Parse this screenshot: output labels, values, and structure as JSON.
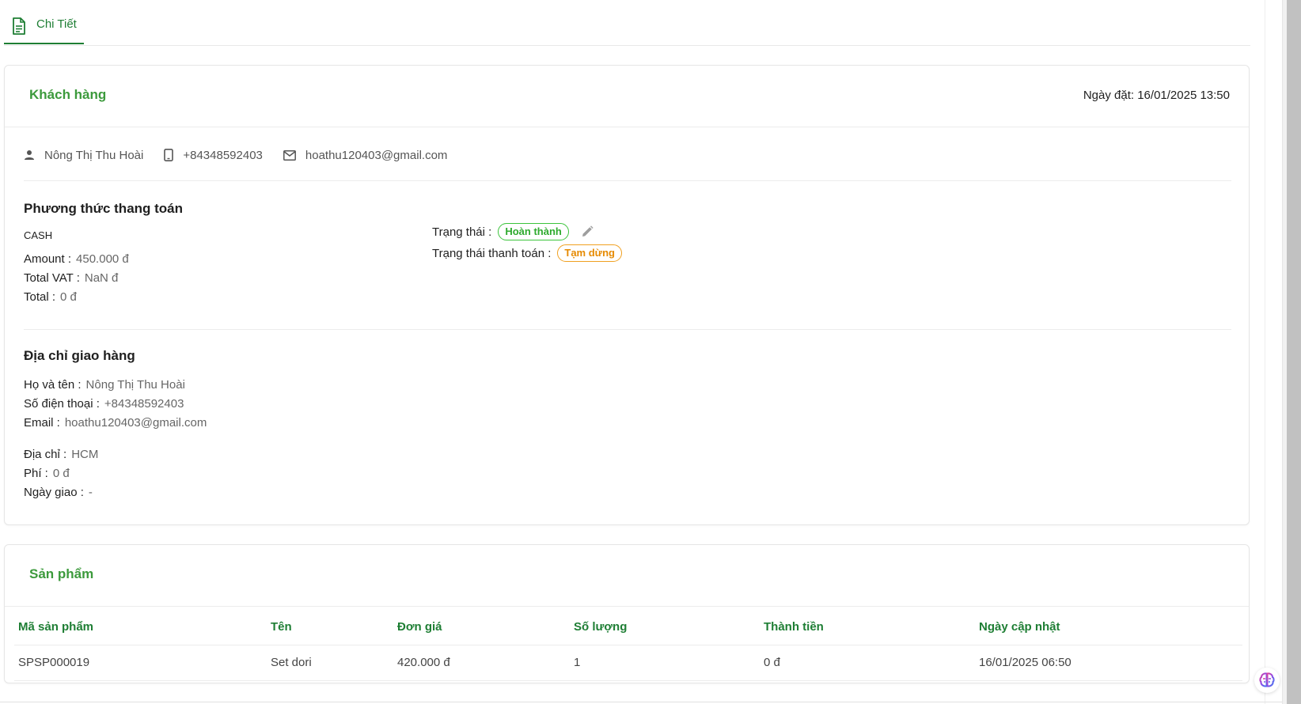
{
  "tabs": [
    {
      "label": "Chi Tiết",
      "icon": "document-icon"
    }
  ],
  "customer_card": {
    "title": "Khách hàng",
    "order_date": "Ngày đặt: 16/01/2025 13:50",
    "contact": {
      "name": "Nông Thị Thu Hoài",
      "phone": "+84348592403",
      "email": "hoathu120403@gmail.com"
    },
    "payment": {
      "title": "Phương thức thang toán",
      "method": "CASH",
      "amount_label": "Amount :",
      "amount_value": "450.000 đ",
      "vat_label": "Total VAT :",
      "vat_value": "NaN đ",
      "total_label": "Total :",
      "total_value": "0 đ"
    },
    "status": {
      "status_label": "Trạng thái :",
      "status_value": "Hoàn thành",
      "payment_status_label": "Trạng thái thanh toán :",
      "payment_status_value": "Tạm dừng"
    },
    "shipping": {
      "title": "Địa chỉ giao hàng",
      "name_label": "Họ và tên :",
      "name_value": "Nông Thị Thu Hoài",
      "phone_label": "Số điện thoại :",
      "phone_value": "+84348592403",
      "email_label": "Email :",
      "email_value": "hoathu120403@gmail.com",
      "address_label": "Địa chỉ :",
      "address_value": "HCM",
      "fee_label": "Phí :",
      "fee_value": "0 đ",
      "delivery_label": "Ngày giao :",
      "delivery_value": "-"
    }
  },
  "products_card": {
    "title": "Sản phẩm",
    "columns": [
      "Mã sản phẩm",
      "Tên",
      "Đơn giá",
      "Số lượng",
      "Thành tiền",
      "Ngày cập nhật"
    ],
    "rows": [
      [
        "SPSP000019",
        "Set dori",
        "420.000 đ",
        "1",
        "0 đ",
        "16/01/2025 06:50"
      ]
    ]
  },
  "colors": {
    "accent": "#1e7e34",
    "title_green": "#3c9a3c",
    "badge_green": "#2eaa2e",
    "badge_orange": "#e68a00"
  }
}
